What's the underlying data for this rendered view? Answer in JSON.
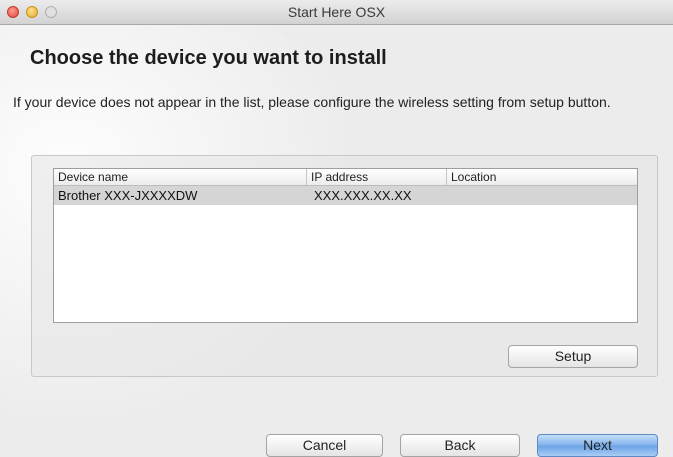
{
  "window": {
    "title": "Start Here OSX"
  },
  "page": {
    "heading": "Choose the device you want to install",
    "description": "If your device does not appear in the list, please configure the wireless setting from setup button."
  },
  "device_list": {
    "columns": [
      "Device name",
      "IP address",
      "Location"
    ],
    "rows": [
      {
        "device_name": "Brother XXX-JXXXXDW",
        "ip_address": "XXX.XXX.XX.XX",
        "location": ""
      }
    ]
  },
  "buttons": {
    "setup": "Setup",
    "cancel": "Cancel",
    "back": "Back",
    "next": "Next"
  },
  "colors": {
    "selected_row": "#d5d5d5",
    "default_button": "#6aa2e6"
  }
}
